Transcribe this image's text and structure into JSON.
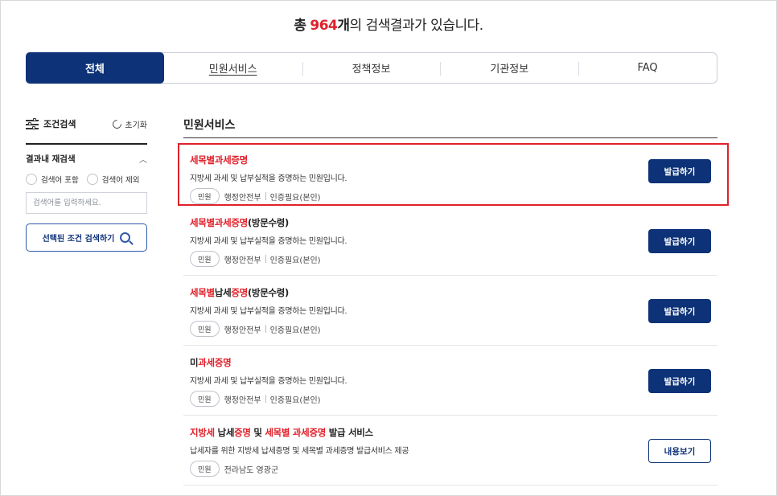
{
  "summary": {
    "prefix": "총",
    "count": "964",
    "unit": "개",
    "suffix": "의 검색결과가 있습니다."
  },
  "tabs": [
    {
      "label": "전체"
    },
    {
      "label": "민원서비스"
    },
    {
      "label": "정책정보"
    },
    {
      "label": "기관정보"
    },
    {
      "label": "FAQ"
    }
  ],
  "sidebar": {
    "title": "조건검색",
    "reset": "초기화",
    "refine_title": "결과내 재검색",
    "radio_include": "검색어 포함",
    "radio_exclude": "검색어 제외",
    "search_placeholder": "검색어를 입력하세요.",
    "search_button": "선택된 조건 검색하기"
  },
  "section_title": "민원서비스",
  "results": [
    {
      "title_parts": [
        [
          "세목별과세증명",
          true
        ]
      ],
      "desc": "지방세 과세 및 납부실적을 증명하는 민원입니다.",
      "badge": "민원",
      "org": "행정안전부",
      "auth": "인증필요(본인)",
      "action": "발급하기"
    },
    {
      "title_parts": [
        [
          "세목별과세증명",
          true
        ],
        [
          "(방문수령)",
          false
        ]
      ],
      "desc": "지방세 과세 및 납부실적을 증명하는 민원입니다.",
      "badge": "민원",
      "org": "행정안전부",
      "auth": "인증필요(본인)",
      "action": "발급하기"
    },
    {
      "title_parts": [
        [
          "세목별",
          true
        ],
        [
          "납세",
          false
        ],
        [
          "증명",
          true
        ],
        [
          "(방문수령)",
          false
        ]
      ],
      "desc": "지방세 과세 및 납부실적을 증명하는 민원입니다.",
      "badge": "민원",
      "org": "행정안전부",
      "auth": "인증필요(본인)",
      "action": "발급하기"
    },
    {
      "title_parts": [
        [
          "미",
          false
        ],
        [
          "과세증명",
          true
        ]
      ],
      "desc": "지방세 과세 및 납부실적을 증명하는 민원입니다.",
      "badge": "민원",
      "org": "행정안전부",
      "auth": "인증필요(본인)",
      "action": "발급하기"
    },
    {
      "title_parts": [
        [
          "지방세",
          true
        ],
        [
          " 납세",
          false
        ],
        [
          "증명",
          true
        ],
        [
          " 및 ",
          false
        ],
        [
          "세목별 과세증명",
          true
        ],
        [
          " 발급 서비스",
          false
        ]
      ],
      "desc": "납세자를 위한 지방세 납세증명 및 세목별 과세증명 발급서비스 제공",
      "badge": "민원",
      "org": "전라남도 영광군",
      "auth": "",
      "action": "내용보기"
    }
  ],
  "colors": {
    "primary": "#0d3277",
    "highlight": "#e0212b"
  }
}
